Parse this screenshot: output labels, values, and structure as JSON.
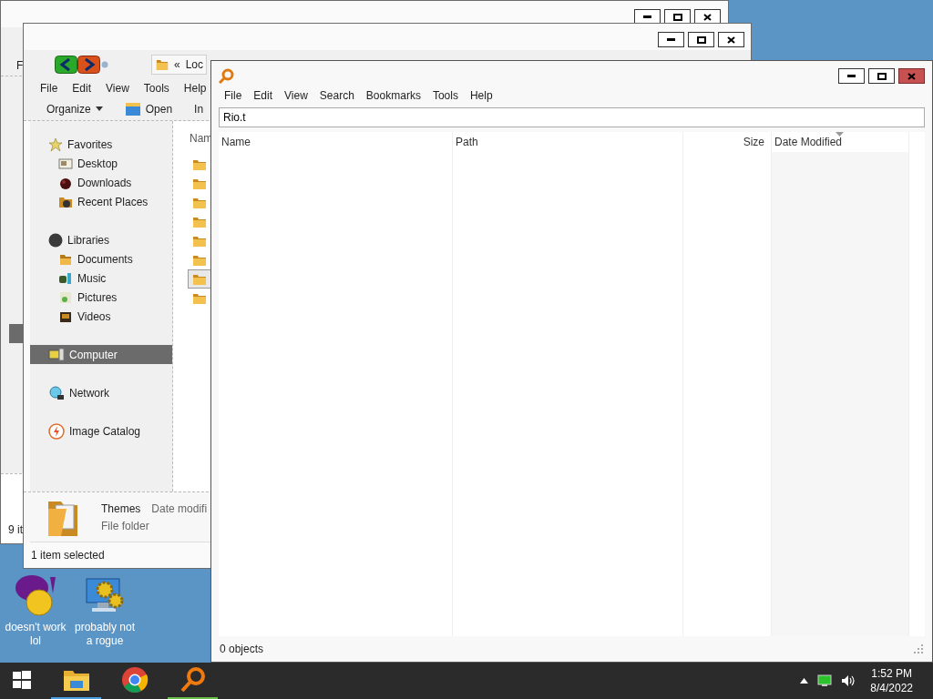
{
  "back_window": {
    "focused": false,
    "menu_fragment": "F",
    "status_fragment": "9 it"
  },
  "explorer_window": {
    "focused": false,
    "address": {
      "chevron": "«",
      "text": "Loc"
    },
    "menu": [
      "File",
      "Edit",
      "View",
      "Tools",
      "Help"
    ],
    "toolbar": [
      {
        "kind": "dropdown",
        "label": "Organize"
      },
      {
        "kind": "open",
        "label": "Open"
      },
      {
        "kind": "plain",
        "label": "In"
      }
    ],
    "sidebar": {
      "items": [
        {
          "kind": "favorites",
          "label": "Favorites",
          "selected": false,
          "children": [
            {
              "kind": "desktop",
              "label": "Desktop",
              "selected": false
            },
            {
              "kind": "downloads",
              "label": "Downloads",
              "selected": false
            },
            {
              "kind": "recent",
              "label": "Recent Places",
              "selected": false
            }
          ]
        },
        {
          "kind": "libraries",
          "label": "Libraries",
          "selected": false,
          "children": [
            {
              "kind": "documents",
              "label": "Documents",
              "selected": false
            },
            {
              "kind": "music",
              "label": "Music",
              "selected": false
            },
            {
              "kind": "pictures",
              "label": "Pictures",
              "selected": false
            },
            {
              "kind": "videos",
              "label": "Videos",
              "selected": false
            }
          ]
        },
        {
          "kind": "computer",
          "label": "Computer",
          "selected": true
        },
        {
          "kind": "network",
          "label": "Network",
          "selected": false
        },
        {
          "kind": "catalog",
          "label": "Image Catalog",
          "selected": false
        }
      ]
    },
    "file_list": {
      "column_1": "Nam",
      "rows": [
        {
          "selected": false
        },
        {
          "selected": false
        },
        {
          "selected": false
        },
        {
          "selected": false
        },
        {
          "selected": false
        },
        {
          "selected": false
        },
        {
          "selected": true
        },
        {
          "selected": false
        }
      ]
    },
    "details": {
      "name": "Themes",
      "date_label": "Date modifi",
      "type": "File folder"
    },
    "status": "1 item selected"
  },
  "search_window": {
    "focused": true,
    "menu": [
      "File",
      "Edit",
      "View",
      "Search",
      "Bookmarks",
      "Tools",
      "Help"
    ],
    "search": {
      "value": "Rio.t"
    },
    "columns": [
      {
        "label": "Name",
        "sorted": false
      },
      {
        "label": "Path",
        "sorted": false
      },
      {
        "label": "Size",
        "sorted": false
      },
      {
        "label": "Date Modified",
        "sorted": true
      }
    ],
    "status": "0 objects"
  },
  "desktop_icons": [
    {
      "kind": "chat",
      "label": "doesn't work lol"
    },
    {
      "kind": "gears",
      "label": "probably not a rogue"
    }
  ],
  "taskbar": {
    "apps": [
      {
        "kind": "start",
        "running": false
      },
      {
        "kind": "folder",
        "running": true
      },
      {
        "kind": "browser",
        "running": false
      },
      {
        "kind": "search",
        "running": true
      }
    ],
    "clock": {
      "time": "1:52 PM",
      "date": "8/4/2022"
    }
  }
}
